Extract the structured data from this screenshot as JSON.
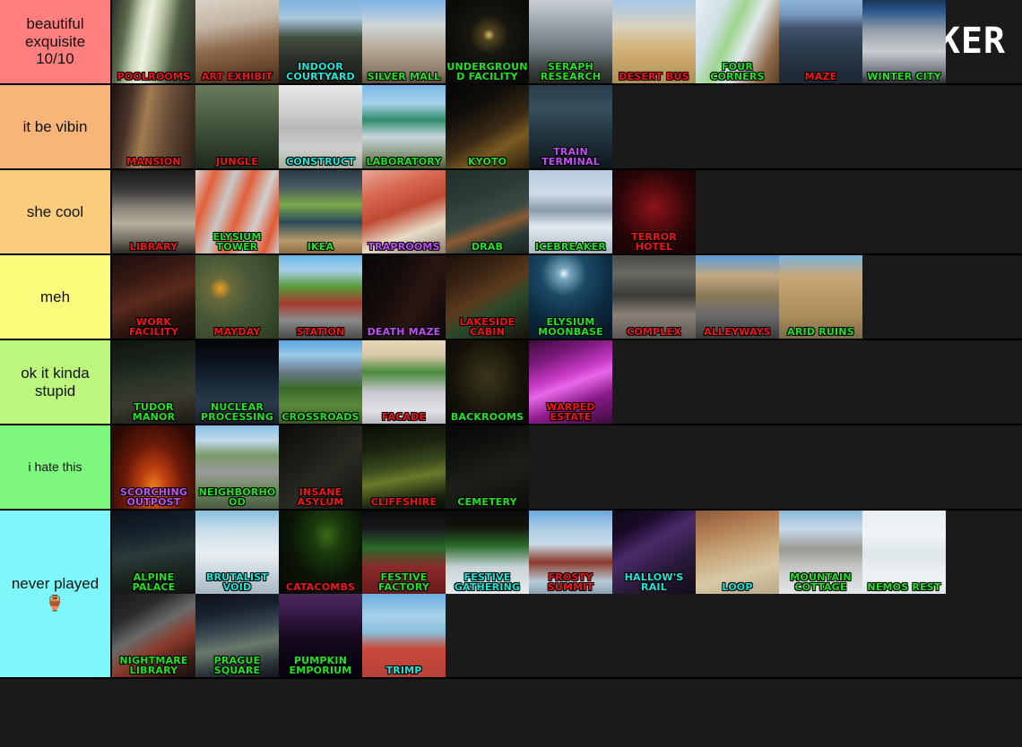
{
  "app": {
    "brand": "TIERMAKER",
    "logo_icon": "tiermaker-grid-logo",
    "background_color": "#1a1a1a",
    "logo_colors": [
      "#ff7f7f",
      "#ff7f7f",
      "#3b3b3b",
      "#3b3b3b",
      "#f5b97f",
      "#f5b97f",
      "#f5b97f",
      "#f5b97f",
      "#f7f77f",
      "#f7f77f",
      "#3b3b3b",
      "#3b3b3b",
      "#7ef07e",
      "#7ef07e",
      "#7ef07e",
      "#3b3b3b"
    ]
  },
  "tiers": [
    {
      "label": "beautiful exquisite 10/10",
      "color": "#ff7f7f",
      "items": [
        {
          "name": "POOLROOMS",
          "cap_color": "red",
          "scene": "poolrooms"
        },
        {
          "name": "ART EXHIBIT",
          "cap_color": "red",
          "scene": "art-exhibit"
        },
        {
          "name": "INDOOR COURTYARD",
          "cap_color": "cyan",
          "scene": "indoor-courtyard"
        },
        {
          "name": "SILVER MALL",
          "cap_color": "green",
          "scene": "silver-mall"
        },
        {
          "name": "UNDERGROUND FACILITY",
          "cap_color": "green",
          "scene": "underground-facility"
        },
        {
          "name": "SERAPH RESEARCH",
          "cap_color": "green",
          "scene": "seraph-research"
        },
        {
          "name": "DESERT BUS",
          "cap_color": "red",
          "scene": "desert-bus"
        },
        {
          "name": "FOUR CORNERS",
          "cap_color": "green",
          "scene": "four-corners"
        },
        {
          "name": "MAZE",
          "cap_color": "red",
          "scene": "maze"
        },
        {
          "name": "WINTER CITY",
          "cap_color": "green",
          "scene": "winter-city"
        }
      ]
    },
    {
      "label": "it be vibin",
      "color": "#f7b578",
      "items": [
        {
          "name": "MANSION",
          "cap_color": "red",
          "scene": "mansion"
        },
        {
          "name": "JUNGLE",
          "cap_color": "red",
          "scene": "jungle"
        },
        {
          "name": "CONSTRUCT",
          "cap_color": "cyan",
          "scene": "construct"
        },
        {
          "name": "LABORATORY",
          "cap_color": "green",
          "scene": "laboratory"
        },
        {
          "name": "KYOTO",
          "cap_color": "green",
          "scene": "kyoto"
        },
        {
          "name": "TRAIN TERMINAL",
          "cap_color": "purple",
          "scene": "train-terminal"
        }
      ]
    },
    {
      "label": "she cool",
      "color": "#facd7d",
      "items": [
        {
          "name": "LIBRARY",
          "cap_color": "red",
          "scene": "library"
        },
        {
          "name": "ELYSIUM TOWER",
          "cap_color": "green",
          "scene": "elysium-tower"
        },
        {
          "name": "IKEA",
          "cap_color": "green",
          "scene": "ikea"
        },
        {
          "name": "TRAPROOMS",
          "cap_color": "purple",
          "scene": "traprooms"
        },
        {
          "name": "DRAB",
          "cap_color": "green",
          "scene": "drab"
        },
        {
          "name": "ICEBREAKER",
          "cap_color": "green",
          "scene": "icebreaker"
        },
        {
          "name": "TERROR HOTEL",
          "cap_color": "red",
          "scene": "terror-hotel"
        }
      ]
    },
    {
      "label": "meh",
      "color": "#fdfd7d",
      "items": [
        {
          "name": "WORK FACILITY",
          "cap_color": "red",
          "scene": "work-facility"
        },
        {
          "name": "MAYDAY",
          "cap_color": "red",
          "scene": "mayday"
        },
        {
          "name": "STATION",
          "cap_color": "red",
          "scene": "station"
        },
        {
          "name": "DEATH MAZE",
          "cap_color": "purple",
          "scene": "death-maze"
        },
        {
          "name": "LAKESIDE CABIN",
          "cap_color": "red",
          "scene": "lakeside-cabin"
        },
        {
          "name": "ELYSIUM MOONBASE",
          "cap_color": "green",
          "scene": "elysium-moonbase"
        },
        {
          "name": "COMPLEX",
          "cap_color": "red",
          "scene": "complex"
        },
        {
          "name": "ALLEYWAYS",
          "cap_color": "red",
          "scene": "alleyways"
        },
        {
          "name": "ARID RUINS",
          "cap_color": "green",
          "scene": "arid-ruins"
        }
      ]
    },
    {
      "label": "ok it kinda stupid",
      "color": "#bdf77d",
      "items": [
        {
          "name": "TUDOR MANOR",
          "cap_color": "green",
          "scene": "tudor-manor"
        },
        {
          "name": "NUCLEAR PROCESSING",
          "cap_color": "green",
          "scene": "nuclear-processing"
        },
        {
          "name": "CROSSROADS",
          "cap_color": "green",
          "scene": "crossroads"
        },
        {
          "name": "FACADE",
          "cap_color": "red",
          "scene": "facade"
        },
        {
          "name": "BACKROOMS",
          "cap_color": "green",
          "scene": "backrooms"
        },
        {
          "name": "WARPED ESTATE",
          "cap_color": "red",
          "scene": "warped-estate"
        }
      ]
    },
    {
      "label": "i hate this",
      "color": "#7df77d",
      "items": [
        {
          "name": "SCORCHING OUTPOST",
          "cap_color": "purple",
          "scene": "scorching-outpost"
        },
        {
          "name": "NEIGHBORHOOD",
          "cap_color": "green",
          "scene": "neighborhood"
        },
        {
          "name": "INSANE ASYLUM",
          "cap_color": "red",
          "scene": "insane-asylum"
        },
        {
          "name": "CLIFFSHIRE",
          "cap_color": "red",
          "scene": "cliffshire"
        },
        {
          "name": "CEMETERY",
          "cap_color": "green",
          "scene": "cemetery"
        }
      ]
    },
    {
      "label": "never played",
      "emoji": "🏺",
      "color": "#7df7fa",
      "items": [
        {
          "name": "ALPINE PALACE",
          "cap_color": "green",
          "scene": "alpine-palace"
        },
        {
          "name": "BRUTALIST VOID",
          "cap_color": "cyan",
          "scene": "brutalist-void"
        },
        {
          "name": "CATACOMBS",
          "cap_color": "red",
          "scene": "catacombs"
        },
        {
          "name": "FESTIVE FACTORY",
          "cap_color": "green",
          "scene": "festive-factory"
        },
        {
          "name": "FESTIVE GATHERING",
          "cap_color": "cyan",
          "scene": "festive-gathering"
        },
        {
          "name": "FROSTY SUMMIT",
          "cap_color": "red",
          "scene": "frosty-summit"
        },
        {
          "name": "HALLOW'S RAIL",
          "cap_color": "cyan",
          "scene": "hallows-rail"
        },
        {
          "name": "LOOP",
          "cap_color": "cyan",
          "scene": "loop"
        },
        {
          "name": "MOUNTAIN COTTAGE",
          "cap_color": "green",
          "scene": "mountain-cottage"
        },
        {
          "name": "NEMOS REST",
          "cap_color": "green",
          "scene": "nemos-rest"
        },
        {
          "name": "NIGHTMARE LIBRARY",
          "cap_color": "green",
          "scene": "nightmare-library"
        },
        {
          "name": "PRAGUE SQUARE",
          "cap_color": "green",
          "scene": "prague-square"
        },
        {
          "name": "PUMPKIN EMPORIUM",
          "cap_color": "green",
          "scene": "pumpkin-emporium"
        },
        {
          "name": "TRIMP",
          "cap_color": "cyan",
          "scene": "trimp"
        }
      ]
    }
  ],
  "scene_styles": {
    "poolrooms": "linear-gradient(100deg,#2a3026 0%,#5d6b4f 18%,#c8d4b4 32%,#eef2e2 42%,#b9c6a4 54%,#4d5a40 72%,#222820 100%)",
    "art-exhibit": "linear-gradient(170deg,#d9d2c6 0%,#c2b4a2 30%,#8d6a4c 55%,#6b4a31 78%,#402a1c 100%)",
    "indoor-courtyard": "linear-gradient(180deg,#7fb5e0 0%,#a8c8dd 22%,#43503f 45%,#2b2f2a 70%,#1a1d18 100%)",
    "silver-mall": "linear-gradient(180deg,#7db4e6 0%,#cfd6da 30%,#b5a893 60%,#8c7e68 85%,#5a4f3e 100%)",
    "underground-facility": "radial-gradient(circle at 52% 42%,#d8c06a 0%,#50431f 9%,#17170f 30%,#0a0a08 70%)",
    "seraph-research": "linear-gradient(180deg,#c9cfd4 0%,#9aa3aa 30%,#6e787f 58%,#3c433f 82%,#23261f 100%)",
    "desert-bus": "linear-gradient(180deg,#a8c8e6 0%,#d8d2c0 32%,#d6b985 52%,#c8a469 74%,#b08f54 100%)",
    "four-corners": "linear-gradient(115deg,#e8eef2 0%,#cfe0e6 25%,#9fd68f 42%,#dfe8ec 58%,#8f6a48 82%,#5a402b 100%)",
    "maze": "linear-gradient(180deg,#8fb4d9 0%,#7a9ec2 16%,#41536b 34%,#2b3a4d 60%,#1c2733 100%)",
    "winter-city": "linear-gradient(180deg,#1b3558 0%,#2e5a8e 14%,#9aa3ab 38%,#c8cdd2 62%,#6a7078 88%,#2a2d30 100%)",
    "mansion": "linear-gradient(100deg,#1d1410 0%,#4a342a 22%,#a07c52 40%,#6b4f38 62%,#2a1d16 100%)",
    "jungle": "linear-gradient(180deg,#6a7c5c 0%,#53654a 28%,#3c4f38 55%,#2b3a28 80%,#1d2a1c 100%)",
    "construct": "linear-gradient(180deg,#e8e8e8 0%,#d2d2d2 28%,#b8b8b8 52%,#cfcfcf 76%,#a8ae9a 100%)",
    "laboratory": "linear-gradient(180deg,#79b8e8 0%,#a8d2ea 22%,#2f8a6a 42%,#c8d8de 62%,#7a8c6a 88%,#4a5a3a 100%)",
    "kyoto": "linear-gradient(150deg,#050505 0%,#120f0a 30%,#3a2a14 55%,#7a5a22 72%,#2a1d0c 100%)",
    "train-terminal": "linear-gradient(180deg,#2a3e4a 0%,#35505c 28%,#23353f 58%,#16232a 85%,#0e161b 100%)",
    "library": "linear-gradient(180deg,#1a1a1a 0%,#3a3a38 24%,#8a8478 46%,#b8b0a0 64%,#6a6458 86%,#2a2824 100%)",
    "elysium-tower": "linear-gradient(110deg,#d8d8d8 0%,#e2603a 18%,#c8c8c8 36%,#e2603a 52%,#d0d0d0 70%,#e05a35 86%,#cfcfcf 100%)",
    "ikea": "linear-gradient(180deg,#2a3a44 0%,#4a5a62 20%,#7aa84a 42%,#2a4a5a 62%,#b89a6a 85%,#8a6a42 100%)",
    "traprooms": "linear-gradient(160deg,#e8a89a 0%,#d86a52 25%,#c04a32 48%,#e8dcc8 72%,#8a7a6a 100%)",
    "drab": "linear-gradient(160deg,#22302c 0%,#2c3a34 30%,#3a4a42 55%,#8a5a32 66%,#2a3a34 80%,#1a2420 100%)",
    "icebreaker": "linear-gradient(180deg,#b8cade 0%,#d0dce8 28%,#8a9aaa 48%,#e2eaf0 68%,#aab8c4 100%)",
    "terror-hotel": "radial-gradient(circle at 50% 45%,#8a1418 0%,#5a0c10 30%,#2a0608 60%,#120204 100%)",
    "work-facility": "linear-gradient(160deg,#1a0e0c 0%,#3a1a14 30%,#5a2a1c 50%,#2a140e 72%,#120806 100%)",
    "mayday": "radial-gradient(circle at 30% 40%,#f0a020 0%,#6a6a3a 14%,#4a5a38 38%,#3a4a2c 70%,#2a3a20 100%)",
    "station": "linear-gradient(180deg,#6ab4e8 0%,#a8d0ea 18%,#5a9a3a 38%,#a83a30 58%,#8a8a8a 78%,#4a4a4a 100%)",
    "death-maze": "linear-gradient(120deg,#070707 0%,#140c0a 35%,#2a1612 62%,#0c0606 100%)",
    "lakeside-cabin": "linear-gradient(150deg,#1a1008 0%,#3a2414 28%,#5a3a1c 48%,#2a4a2a 64%,#1a1008 100%)",
    "elysium-moonbase": "radial-gradient(circle at 42% 22%,#f0f4f8 0%,#7aa8c0 7%,#1a4a66 28%,#0c2a3e 60%,#061420 100%)",
    "complex": "linear-gradient(180deg,#4a4a46 0%,#6a6a62 22%,#3a3a36 48%,#8a8278 72%,#5a5650 100%)",
    "alleyways": "linear-gradient(180deg,#5a9ad8 0%,#c2a880 25%,#8a7a5a 48%,#6a6a6a 72%,#3a3a3a 100%)",
    "arid-ruins": "linear-gradient(180deg,#7ab4e0 0%,#c8a878 25%,#b89a68 50%,#a88a58 75%,#7a6a48 100%)",
    "tudor-manor": "linear-gradient(170deg,#0e1410 0%,#1a241a 28%,#2a3428 48%,#3a3a30 68%,#1a1a14 100%)",
    "nuclear-processing": "linear-gradient(180deg,#050508 0%,#0c1420 28%,#1a2a3a 52%,#2a3a4a 76%,#14202c 100%)",
    "crossroads": "linear-gradient(180deg,#5aa8e0 0%,#9ac8e8 18%,#6a7a8a 38%,#3a6a2a 58%,#5a8a3a 78%,#3a5a22 100%)",
    "facade": "linear-gradient(180deg,#e8d8b8 0%,#d8c8a8 18%,#4a8a3a 38%,#c8c8d0 62%,#e0e0e4 85%,#b8b8c0 100%)",
    "backrooms": "radial-gradient(ellipse at 50% 45%,#3a3418 0%,#2a2614 28%,#141208 60%,#080704 100%)",
    "warped-estate": "linear-gradient(160deg,#3a0c3a 0%,#7a1a7a 22%,#c83ac8 42%,#e868e8 52%,#8a1a8a 72%,#3a0c3a 100%)",
    "scorching-outpost": "radial-gradient(ellipse at 50% 75%,#f08020 0%,#c04010 22%,#6a1a08 50%,#2a0a04 85%)",
    "neighborhood": "linear-gradient(180deg,#8ac0e8 0%,#c0d8ea 18%,#7a9a6a 36%,#9a9a9a 56%,#6a8a5a 78%,#4a5a44 100%)",
    "insane-asylum": "linear-gradient(140deg,#0a0a08 0%,#1a1a16 32%,#2a2a22 58%,#121210 100%)",
    "cliffshire": "linear-gradient(170deg,#0a0e06 0%,#1a2410 28%,#3a4a1c 48%,#6a7a2a 62%,#1a2410 85%,#0a0e06 100%)",
    "cemetery": "linear-gradient(160deg,#060608 0%,#10120e 30%,#1c2018 58%,#0a0c08 100%)",
    "alpine-palace": "linear-gradient(170deg,#0a1018 0%,#16222c 28%,#2a3a3a 50%,#1a2420 75%,#0c120e 100%)",
    "brutalist-void": "linear-gradient(180deg,#8ac0e0 0%,#cfe0ea 26%,#e8eef2 52%,#c8d4dc 76%,#a8b8c4 100%)",
    "catacombs": "radial-gradient(ellipse at 58% 30%,#3a6a18 0%,#1a3a0c 22%,#0a1406 55%,#050a04 100%)",
    "festive-factory": "linear-gradient(180deg,#0a0a0c 0%,#1a1a1e 22%,#2a6a2a 45%,#8a2a2a 68%,#6a1a1a 100%)",
    "festive-gathering": "linear-gradient(180deg,#0a0a0c 0%,#14140c 20%,#2a6a2a 42%,#c8d4d8 68%,#e8eef0 100%)",
    "frosty-summit": "linear-gradient(180deg,#6aa8dc 0%,#a8cae6 20%,#c8dce8 40%,#8a3a2a 62%,#b8ccd8 85%,#8aa0ae 100%)",
    "hallows-rail": "linear-gradient(150deg,#0a0a12 0%,#1a0a2a 22%,#4a2a6a 42%,#2a1a3a 68%,#120a1a 100%)",
    "loop": "linear-gradient(165deg,#8a5a3a 0%,#b07a52 22%,#c8a87a 48%,#d8c8a8 72%,#b8a888 100%)",
    "mountain-cottage": "linear-gradient(180deg,#8ab8d8 0%,#c8dae8 22%,#9a9a94 46%,#c8ccc8 70%,#e2e6e8 100%)",
    "nemos-rest": "linear-gradient(180deg,#e8eef2 0%,#f0f4f6 28%,#dde6ea 52%,#eef2f4 78%,#e0e8ec 100%)",
    "nightmare-library": "linear-gradient(150deg,#1a1a1c 0%,#2a2a2c 24%,#6a6a68 44%,#8a3a2a 62%,#3a1a14 85%,#141010 100%)",
    "prague-square": "linear-gradient(170deg,#0c1018 0%,#1a2230 24%,#3a4a52 44%,#6a7a6a 62%,#2a3238 84%,#12161c 100%)",
    "pumpkin-emporium": "linear-gradient(180deg,#4a2a5a 0%,#3a1a4a 22%,#1a0a22 48%,#0c0614 72%,#060310 100%)",
    "trimp": "linear-gradient(180deg,#6ab0e0 0%,#a8d0e8 26%,#8ac0dc 46%,#c84a3a 66%,#b8423a 100%)"
  }
}
